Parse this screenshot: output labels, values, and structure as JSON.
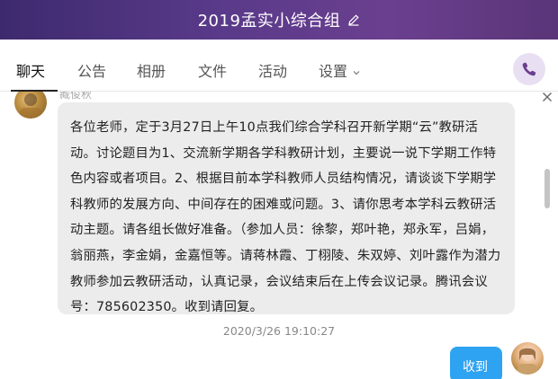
{
  "window": {
    "title": "2019孟实小综合组",
    "edit_icon": "pencil-icon"
  },
  "tabs": [
    {
      "label": "聊天",
      "active": true
    },
    {
      "label": "公告",
      "active": false
    },
    {
      "label": "相册",
      "active": false
    },
    {
      "label": "文件",
      "active": false
    },
    {
      "label": "活动",
      "active": false
    },
    {
      "label": "设置",
      "active": false
    }
  ],
  "call_icon": "phone-icon",
  "colors": {
    "titlebar": "#5a3a8a",
    "accent_call": "#6b3f8f",
    "my_bubble": "#2ea3f2",
    "other_bubble": "#ececec"
  },
  "message": {
    "sender": "臧俊秋",
    "text": "各位老师，定于3月27日上午10点我们综合学科召开新学期“云”教研活动。讨论题目为1、交流新学期各学科教研计划，主要说一说下学期工作特色内容或者项目。2、根据目前本学科教师人员结构情况，请谈谈下学期学科教师的发展方向、中间存在的困难或问题。3、请你思考本学科云教研活动主题。请各组长做好准备。（参加人员：徐黎，郑叶艳，郑永军，吕娟，翁丽燕，李金娟，金嘉恒等。请蒋林霞、丁栩陵、朱双婷、刘叶露作为潜力教师参加云教研活动，认真记录，会议结束后在上传会议记录。腾讯会议号：785602350。收到请回复。",
    "timestamp": "2020/3/26 19:10:27"
  },
  "reply": {
    "text": "收到"
  }
}
